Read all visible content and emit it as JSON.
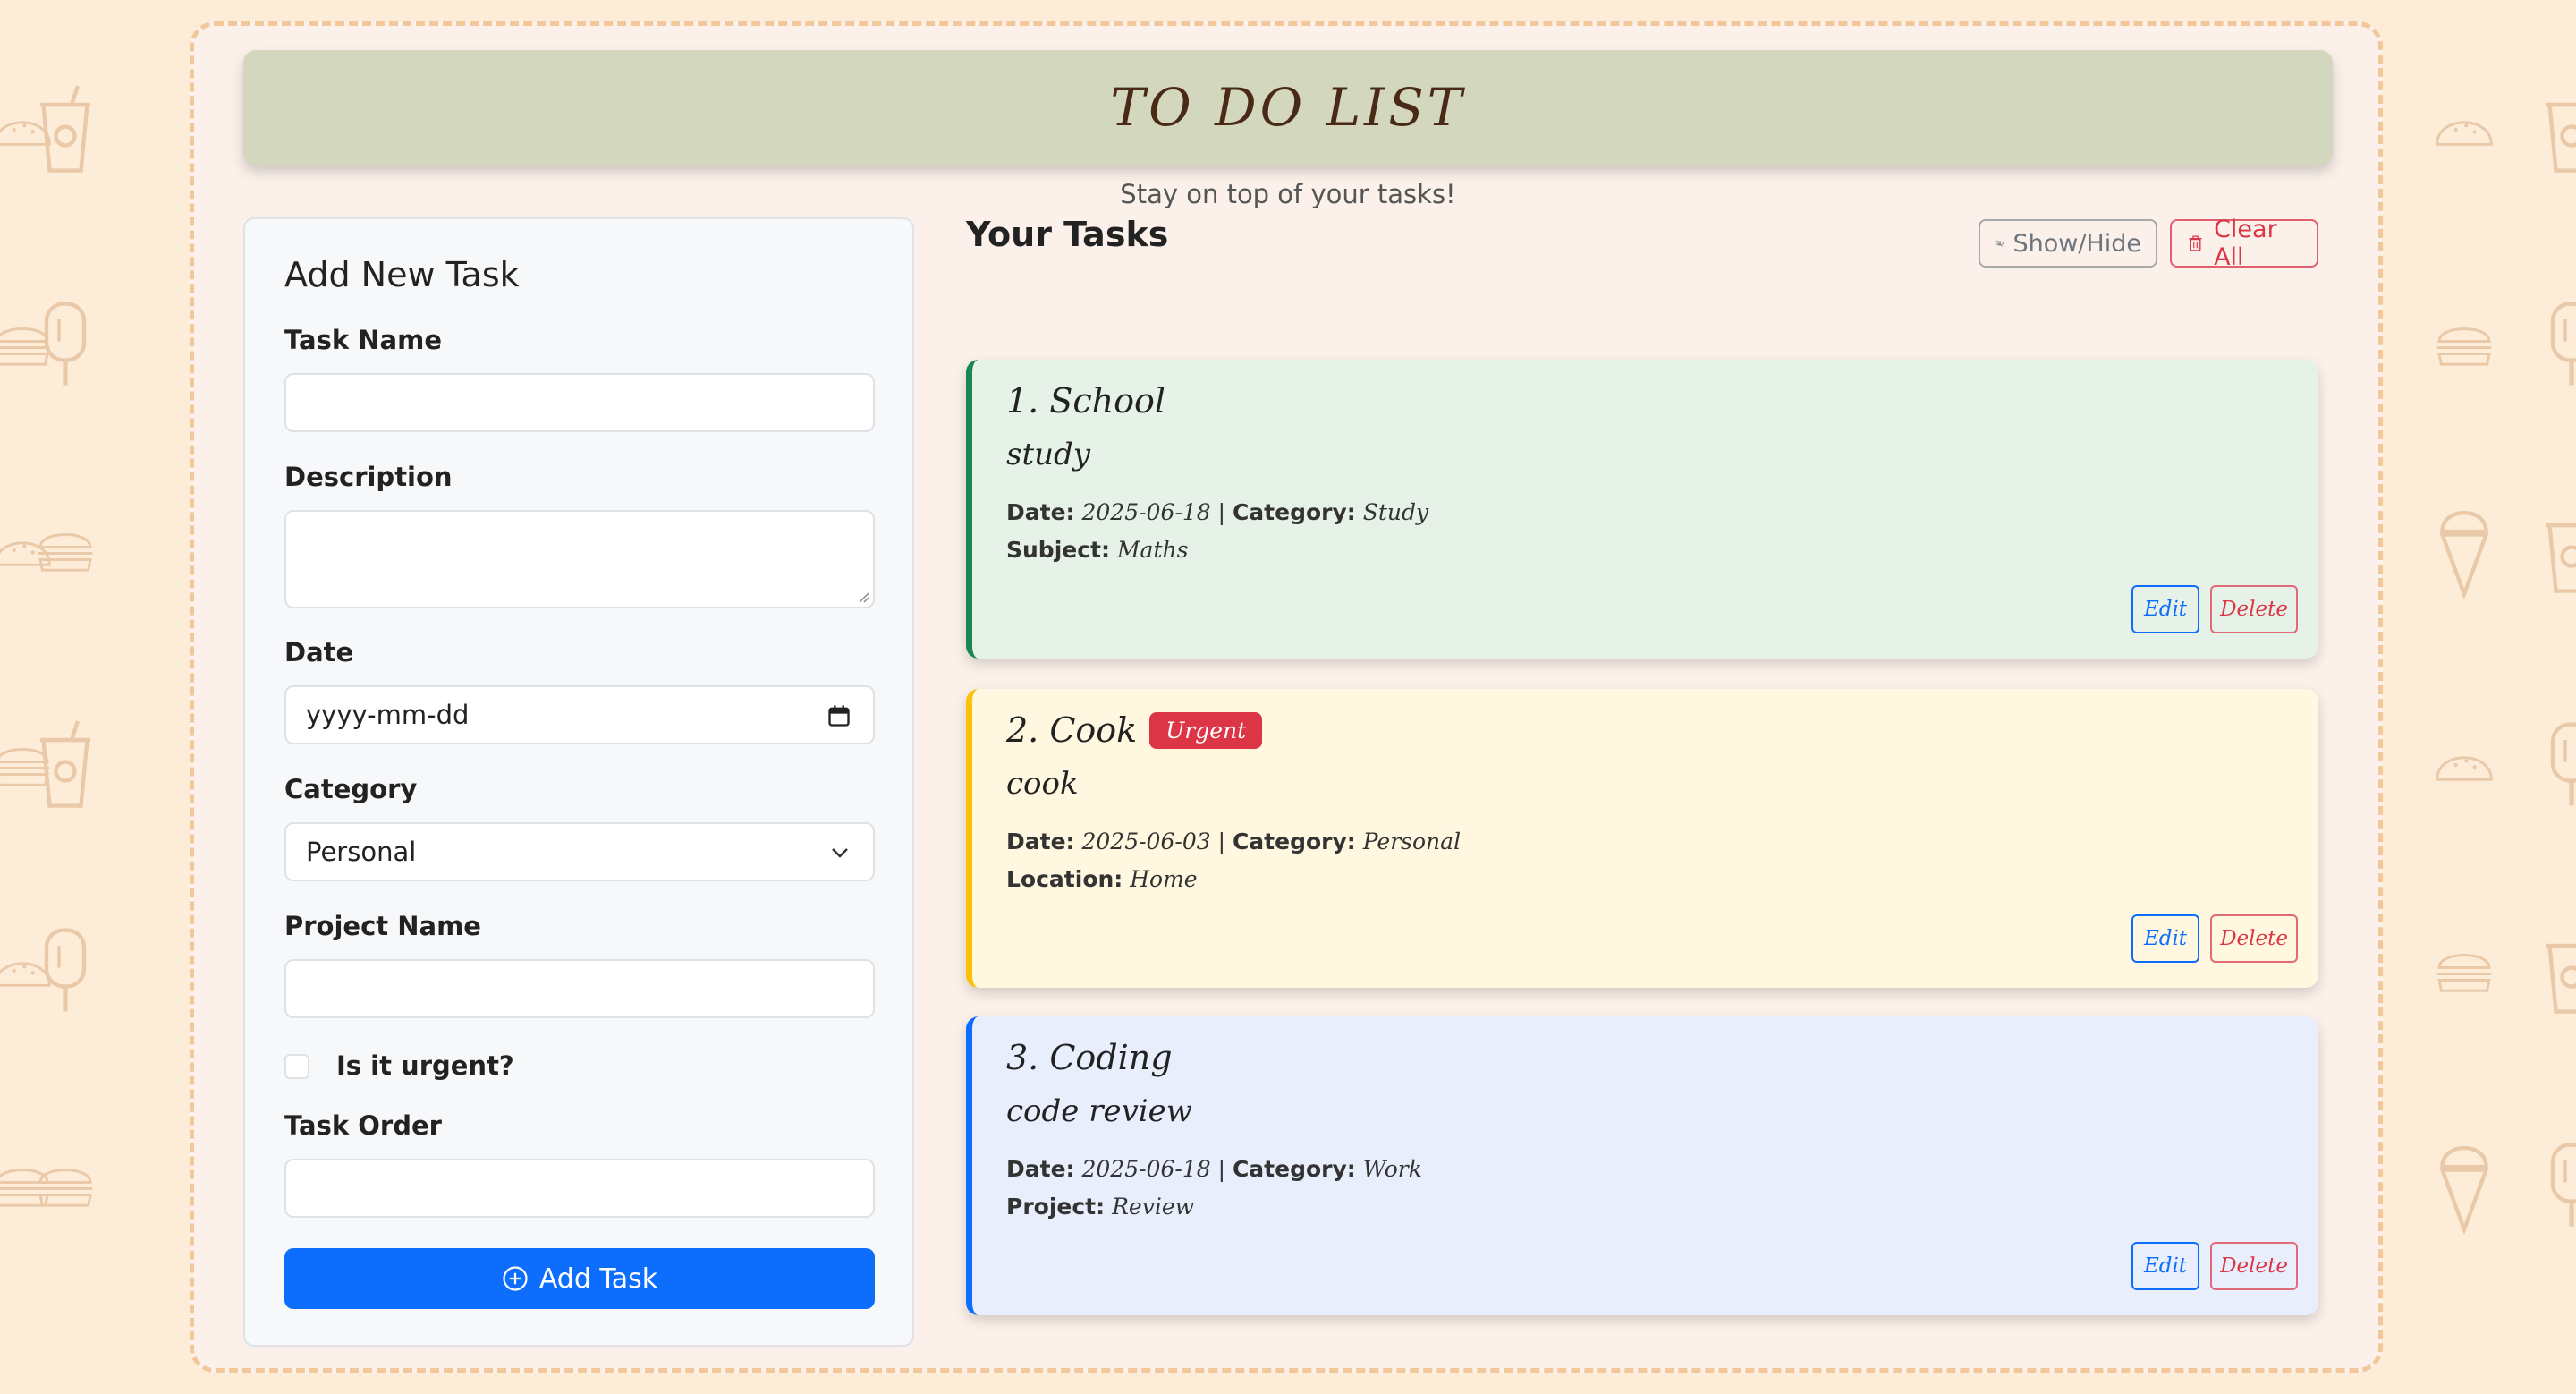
{
  "app": {
    "title": "TO DO LIST",
    "tagline": "Stay on top of your tasks!"
  },
  "form": {
    "title": "Add New Task",
    "task_name_label": "Task Name",
    "task_name_value": "",
    "description_label": "Description",
    "description_value": "",
    "date_label": "Date",
    "date_placeholder": "yyyy-mm-dd",
    "category_label": "Category",
    "category_selected": "Personal",
    "project_name_label": "Project Name",
    "project_name_value": "",
    "urgent_label": "Is it urgent?",
    "urgent_checked": false,
    "task_order_label": "Task Order",
    "task_order_value": "",
    "add_button_label": "Add Task"
  },
  "tasks_panel": {
    "heading": "Your Tasks",
    "show_hide_label": "Show/Hide",
    "clear_all_label": "Clear All"
  },
  "tasks": [
    {
      "title": "1. School",
      "urgent": false,
      "description": "study",
      "date_label": "Date:",
      "date": "2025-06-18",
      "category_label": "Category:",
      "category": "Study",
      "extra_label": "Subject:",
      "extra_value": "Maths",
      "edit_label": "Edit",
      "delete_label": "Delete",
      "bg_color": "#e6f2e8",
      "accent_color": "#198754"
    },
    {
      "title": "2. Cook",
      "urgent": true,
      "urgent_label": "Urgent",
      "description": "cook",
      "date_label": "Date:",
      "date": "2025-06-03",
      "category_label": "Category:",
      "category": "Personal",
      "extra_label": "Location:",
      "extra_value": "Home",
      "edit_label": "Edit",
      "delete_label": "Delete",
      "bg_color": "#fff7df",
      "accent_color": "#ffc107"
    },
    {
      "title": "3. Coding",
      "urgent": false,
      "description": "code review",
      "date_label": "Date:",
      "date": "2025-06-18",
      "category_label": "Category:",
      "category": "Work",
      "extra_label": "Project:",
      "extra_value": "Review",
      "edit_label": "Edit",
      "delete_label": "Delete",
      "bg_color": "#e8eefc",
      "accent_color": "#0d6efd"
    }
  ],
  "colors": {
    "page_bg": "#fdecd8",
    "frame_bg": "#fbf1ea",
    "header_bg": "#d2d7bd",
    "primary": "#0d6efd",
    "danger": "#dc3545"
  }
}
